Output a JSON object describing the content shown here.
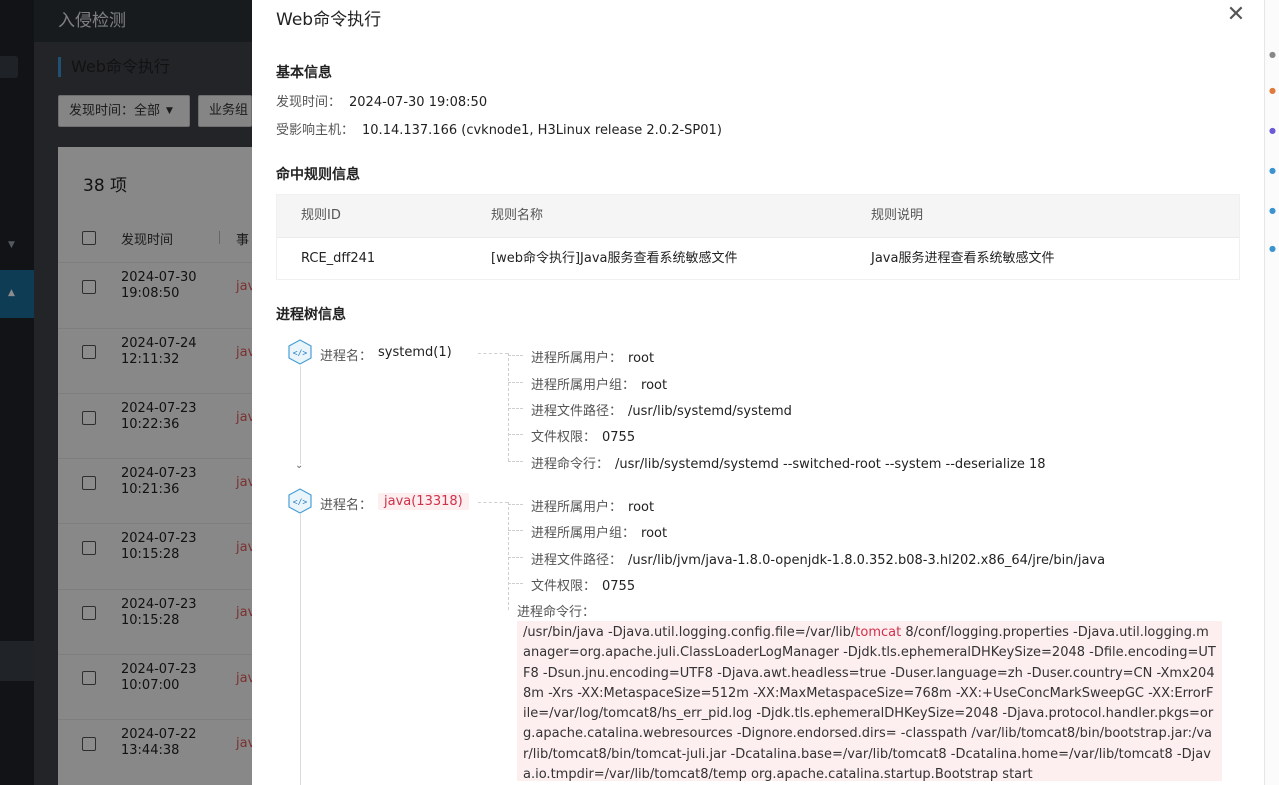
{
  "background": {
    "header_title": "入侵检测",
    "subtitle": "Web命令执行",
    "filters": [
      {
        "label": "发现时间：全部"
      },
      {
        "label": "业务组"
      }
    ],
    "count_label": "38 项",
    "columns": [
      "发现时间",
      "事"
    ],
    "rows": [
      {
        "date": "2024-07-30",
        "time": "19:08:50",
        "event": "jav"
      },
      {
        "date": "2024-07-24",
        "time": "12:11:32",
        "event": "jav"
      },
      {
        "date": "2024-07-23",
        "time": "10:22:36",
        "event": "jav"
      },
      {
        "date": "2024-07-23",
        "time": "10:21:36",
        "event": "jav"
      },
      {
        "date": "2024-07-23",
        "time": "10:15:28",
        "event": "jav"
      },
      {
        "date": "2024-07-23",
        "time": "10:15:28",
        "event": "jav"
      },
      {
        "date": "2024-07-23",
        "time": "10:07:00",
        "event": "jav"
      },
      {
        "date": "2024-07-22",
        "time": "13:44:38",
        "event": "jav"
      }
    ]
  },
  "drawer": {
    "title": "Web命令执行",
    "close_icon": "close-icon",
    "basic": {
      "title": "基本信息",
      "found_time_label": "发现时间：",
      "found_time": "2024-07-30 19:08:50",
      "host_label": "受影响主机：",
      "host": "10.14.137.166 (cvknode1, H3Linux release 2.0.2-SP01)"
    },
    "rule": {
      "title": "命中规则信息",
      "headers": [
        "规则ID",
        "规则名称",
        "规则说明"
      ],
      "row": [
        "RCE_dff241",
        "[web命令执行]Java服务查看系统敏感文件",
        "Java服务进程查看系统敏感文件"
      ]
    },
    "tree": {
      "title": "进程树信息",
      "name_label": "进程名：",
      "nodes": [
        {
          "name": "systemd(1)",
          "details": [
            {
              "label": "进程所属用户：",
              "value": "root"
            },
            {
              "label": "进程所属用户组：",
              "value": "root"
            },
            {
              "label": "进程文件路径：",
              "value": "/usr/lib/systemd/systemd"
            },
            {
              "label": "文件权限：",
              "value": "0755"
            },
            {
              "label": "进程命令行：",
              "value": "/usr/lib/systemd/systemd --switched-root --system --deserialize 18"
            }
          ]
        },
        {
          "name": "java(13318)",
          "details": [
            {
              "label": "进程所属用户：",
              "value": "root"
            },
            {
              "label": "进程所属用户组：",
              "value": "root"
            },
            {
              "label": "进程文件路径：",
              "value": "/usr/lib/jvm/java-1.8.0-openjdk-1.8.0.352.b08-3.hl202.x86_64/jre/bin/java"
            },
            {
              "label": "文件权限：",
              "value": "0755"
            }
          ],
          "cmd_label": "进程命令行：",
          "cmd_before": "/usr/bin/java -Djava.util.logging.config.file=/var/lib/",
          "cmd_keyword": "tomcat",
          "cmd_after": " 8/conf/logging.properties -Djava.util.logging.manager=org.apache.juli.ClassLoaderLogManager -Djdk.tls.ephemeralDHKeySize=2048 -Dfile.encoding=UTF8 -Dsun.jnu.encoding=UTF8 -Djava.awt.headless=true -Duser.language=zh -Duser.country=CN -Xmx2048m -Xrs -XX:MetaspaceSize=512m -XX:MaxMetaspaceSize=768m -XX:+UseConcMarkSweepGC -XX:ErrorFile=/var/log/tomcat8/hs_err_pid.log -Djdk.tls.ephemeralDHKeySize=2048 -Djava.protocol.handler.pkgs=org.apache.catalina.webresources -Dignore.endorsed.dirs= -classpath /var/lib/tomcat8/bin/bootstrap.jar:/var/lib/tomcat8/bin/tomcat-juli.jar -Dcatalina.base=/var/lib/tomcat8 -Dcatalina.home=/var/lib/tomcat8 -Djava.io.tmpdir=/var/lib/tomcat8/temp org.apache.catalina.startup.Bootstrap start"
        }
      ]
    }
  },
  "colors": {
    "accent": "#1b6e9b",
    "highlight_text": "#d0314a",
    "highlight_bg": "#fdeef0"
  }
}
